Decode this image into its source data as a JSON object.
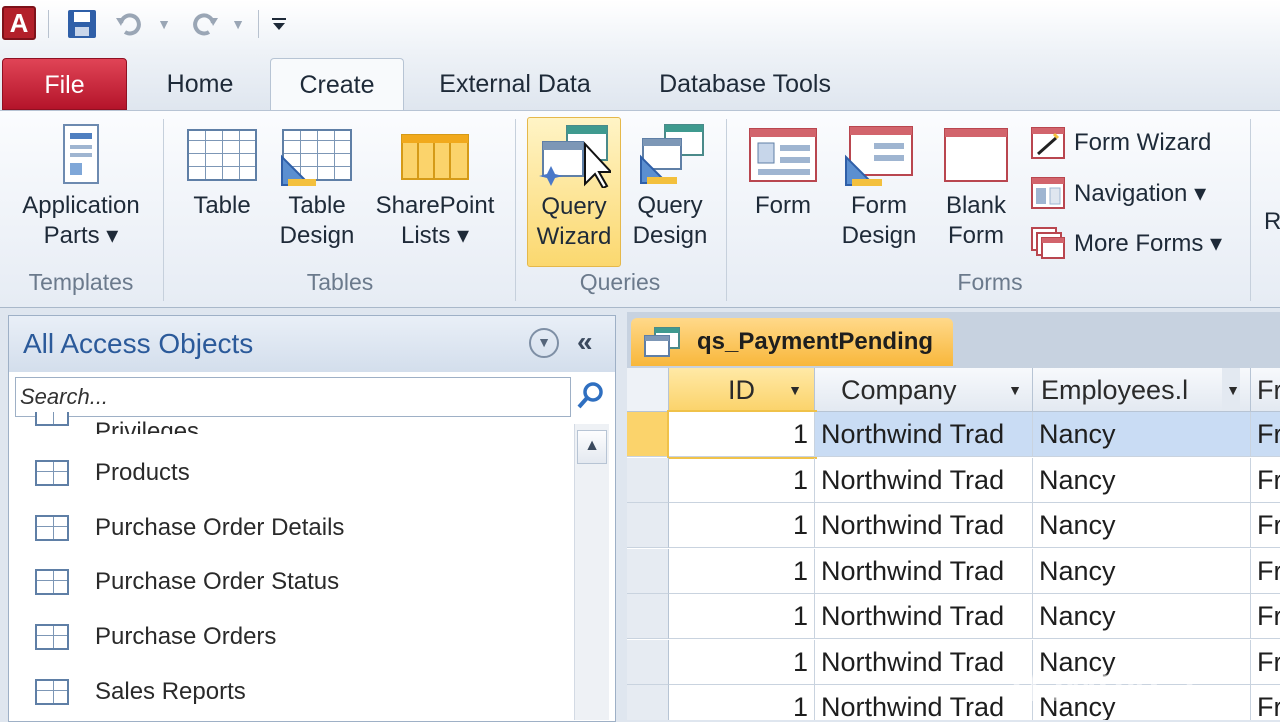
{
  "app": {
    "logo_letter": "A"
  },
  "tabs": [
    "File",
    "Home",
    "Create",
    "External Data",
    "Database Tools"
  ],
  "ribbon": {
    "templates": {
      "group": "Templates",
      "application_parts": [
        "Application",
        "Parts ▾"
      ]
    },
    "tables": {
      "group": "Tables",
      "table": "Table",
      "table_design": [
        "Table",
        "Design"
      ],
      "sharepoint_lists": [
        "SharePoint",
        "Lists ▾"
      ]
    },
    "queries": {
      "group": "Queries",
      "query_wizard": [
        "Query",
        "Wizard"
      ],
      "query_design": [
        "Query",
        "Design"
      ]
    },
    "forms": {
      "group": "Forms",
      "form": "Form",
      "form_design": [
        "Form",
        "Design"
      ],
      "blank_form": [
        "Blank",
        "Form"
      ],
      "form_wizard": "Form Wizard",
      "navigation": "Navigation ▾",
      "more_forms": "More Forms ▾"
    },
    "cut_letter": "R"
  },
  "nav": {
    "title": "All Access Objects",
    "search_placeholder": "Search...",
    "partial_item": "Privileges",
    "items": [
      "Products",
      "Purchase Order Details",
      "Purchase Order Status",
      "Purchase Orders",
      "Sales Reports"
    ]
  },
  "datasheet": {
    "tab": "qs_PaymentPending",
    "columns": [
      "ID",
      "Company",
      "Employees.l",
      "Fr"
    ],
    "rows": [
      [
        "1",
        "Northwind Trad",
        "Nancy",
        "Fr"
      ],
      [
        "1",
        "Northwind Trad",
        "Nancy",
        "Fr"
      ],
      [
        "1",
        "Northwind Trad",
        "Nancy",
        "Fr"
      ],
      [
        "1",
        "Northwind Trad",
        "Nancy",
        "Fr"
      ],
      [
        "1",
        "Northwind Trad",
        "Nancy",
        "Fr"
      ],
      [
        "1",
        "Northwind Trad",
        "Nancy",
        "Fr"
      ],
      [
        "1",
        "Northwind Trad",
        "Nancy",
        "Fr"
      ]
    ]
  },
  "watermark": "H-IMPACT",
  "colors": {
    "file_tab": "#c8192e",
    "active_tab_header": "#f8b73b",
    "query_wizard_highlight": "#fbd86f",
    "nav_title": "#2b5a9a"
  }
}
